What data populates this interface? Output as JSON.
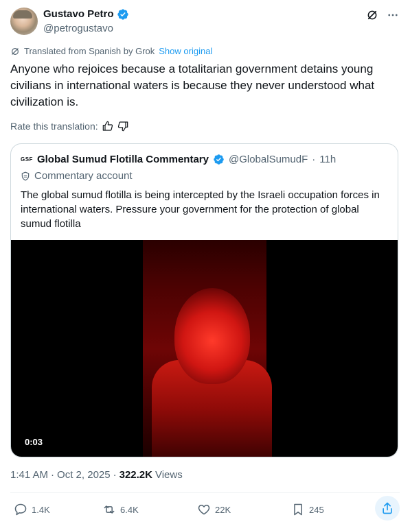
{
  "author": {
    "name": "Gustavo Petro",
    "handle": "@petrogustavo",
    "verified": true
  },
  "translation": {
    "label": "Translated from Spanish by Grok",
    "show_original": "Show original",
    "rate_label": "Rate this translation:"
  },
  "post_text": "Anyone who rejoices because a totalitarian government detains young civilians in international waters is because they never understood what civilization is.",
  "quote": {
    "logo_text": "GSF",
    "name": "Global Sumud Flotilla Commentary",
    "handle": "@GlobalSumudF",
    "separator": "·",
    "time": "11h",
    "account_type": "Commentary account",
    "text": "The global sumud flotilla is being intercepted by the Israeli occupation forces in international waters. Pressure your government for the protection of global sumud flotilla",
    "video_timecode": "0:03"
  },
  "meta": {
    "time": "1:41 AM",
    "separator": "·",
    "date": "Oct 2, 2025",
    "views_count": "322.2K",
    "views_label": "Views"
  },
  "actions": {
    "replies": "1.4K",
    "reposts": "6.4K",
    "likes": "22K",
    "bookmarks": "245"
  },
  "colors": {
    "accent": "#1d9bf0",
    "secondary_text": "#536471",
    "primary_text": "#0f1419"
  }
}
